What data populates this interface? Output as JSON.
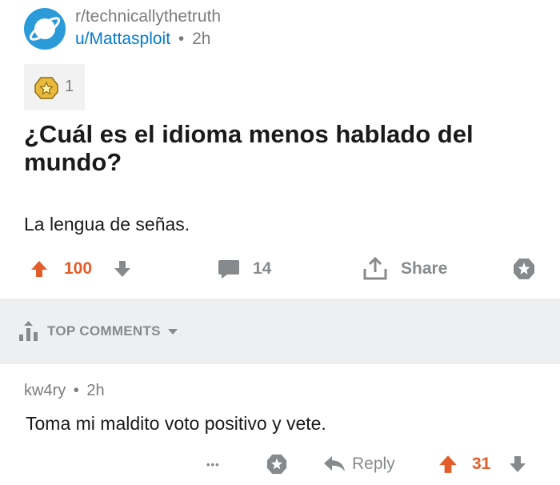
{
  "post": {
    "subreddit": "r/technicallythetruth",
    "author": "u/Mattasploit",
    "separator": "•",
    "age": "2h",
    "award_count": "1",
    "title": "¿Cuál es el idioma menos hablado del mundo?",
    "body": "La lengua de señas.",
    "score": "100",
    "comments": "14",
    "share_label": "Share"
  },
  "comments_section": {
    "sort_label": "TOP COMMENTS"
  },
  "comment": {
    "author": "kw4ry",
    "separator": "•",
    "age": "2h",
    "text": "Toma mi maldito voto positivo y vete.",
    "more": "•••",
    "reply_label": "Reply",
    "score": "31"
  },
  "colors": {
    "upvote": "#e35d2a",
    "link": "#0079d3",
    "muted": "#878a8c",
    "band": "#edeff1",
    "subreddit_icon": "#2a9bd8"
  },
  "icons": [
    "planet-icon",
    "award-icon",
    "upvote-icon",
    "downvote-icon",
    "comment-icon",
    "share-icon",
    "gild-icon",
    "top-sort-icon",
    "chevron-down-icon",
    "reply-icon"
  ]
}
